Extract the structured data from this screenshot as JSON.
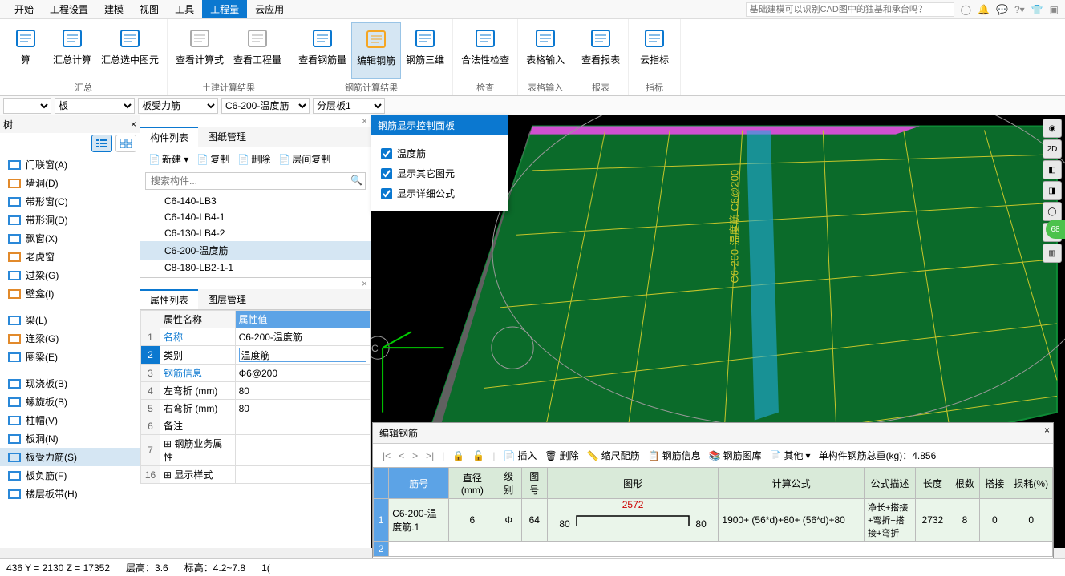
{
  "menu": {
    "items": [
      "开始",
      "工程设置",
      "建模",
      "视图",
      "工具",
      "工程量",
      "云应用"
    ],
    "active": 5,
    "search_placeholder": "基础建模可以识别CAD图中的独基和承台吗？"
  },
  "ribbon": {
    "groups": [
      {
        "label": "汇总",
        "buttons": [
          {
            "name": "calc",
            "label": "算",
            "color": "#0b78d0"
          },
          {
            "name": "sum-calc",
            "label": "汇总计算",
            "color": "#0b78d0"
          },
          {
            "name": "sum-select",
            "label": "汇总选中图元",
            "color": "#0b78d0"
          }
        ]
      },
      {
        "label": "土建计算结果",
        "buttons": [
          {
            "name": "view-formula",
            "label": "查看计算式",
            "color": "#aaa"
          },
          {
            "name": "view-engqty",
            "label": "查看工程量",
            "color": "#aaa"
          }
        ]
      },
      {
        "label": "钢筋计算结果",
        "buttons": [
          {
            "name": "view-rebar",
            "label": "查看钢筋量",
            "color": "#0b78d0"
          },
          {
            "name": "edit-rebar",
            "label": "编辑钢筋",
            "color": "#f5a623",
            "active": true
          },
          {
            "name": "rebar-3d",
            "label": "钢筋三维",
            "color": "#0b78d0"
          }
        ]
      },
      {
        "label": "检查",
        "buttons": [
          {
            "name": "legal-check",
            "label": "合法性检查",
            "color": "#0b78d0"
          }
        ]
      },
      {
        "label": "表格输入",
        "buttons": [
          {
            "name": "table-input",
            "label": "表格输入",
            "color": "#0b78d0"
          }
        ]
      },
      {
        "label": "报表",
        "buttons": [
          {
            "name": "view-report",
            "label": "查看报表",
            "color": "#0b78d0"
          }
        ]
      },
      {
        "label": "指标",
        "buttons": [
          {
            "name": "cloud-index",
            "label": "云指标",
            "color": "#0b78d0"
          }
        ]
      }
    ]
  },
  "selectors": [
    {
      "value": ""
    },
    {
      "value": "板"
    },
    {
      "value": "板受力筋"
    },
    {
      "value": "C6-200-温度筋"
    },
    {
      "value": "分层板1"
    }
  ],
  "left": {
    "title": "树",
    "items": [
      {
        "icon": "#2a88d8",
        "label": "门联窗(A)"
      },
      {
        "icon": "#e28a2b",
        "label": "墙洞(D)"
      },
      {
        "icon": "#2a88d8",
        "label": "带形窗(C)"
      },
      {
        "icon": "#2a88d8",
        "label": "带形洞(D)"
      },
      {
        "icon": "#2a88d8",
        "label": "飘窗(X)"
      },
      {
        "icon": "#e28a2b",
        "label": "老虎窗"
      },
      {
        "icon": "#2a88d8",
        "label": "过梁(G)"
      },
      {
        "icon": "#e28a2b",
        "label": "壁龛(I)"
      },
      {
        "icon": "",
        "label": ""
      },
      {
        "icon": "#2a88d8",
        "label": "梁(L)"
      },
      {
        "icon": "#e28a2b",
        "label": "连梁(G)"
      },
      {
        "icon": "#2a88d8",
        "label": "圈梁(E)"
      },
      {
        "icon": "",
        "label": ""
      },
      {
        "icon": "#2a88d8",
        "label": "现浇板(B)"
      },
      {
        "icon": "#2a88d8",
        "label": "螺旋板(B)"
      },
      {
        "icon": "#2a88d8",
        "label": "柱帽(V)"
      },
      {
        "icon": "#2a88d8",
        "label": "板洞(N)"
      },
      {
        "icon": "#2a88d8",
        "label": "板受力筋(S)",
        "sel": true
      },
      {
        "icon": "#2a88d8",
        "label": "板负筋(F)"
      },
      {
        "icon": "#2a88d8",
        "label": "楼层板带(H)"
      }
    ]
  },
  "mid": {
    "tabs": [
      "构件列表",
      "图纸管理"
    ],
    "active_tab": 0,
    "toolbar": [
      {
        "name": "new",
        "label": "新建",
        "drop": true
      },
      {
        "name": "copy",
        "label": "复制"
      },
      {
        "name": "delete",
        "label": "删除"
      },
      {
        "name": "layer-copy",
        "label": "层间复制"
      }
    ],
    "search_placeholder": "搜索构件...",
    "components": [
      "C6-140-LB3",
      "C6-140-LB4-1",
      "C6-130-LB4-2",
      "C6-200-温度筋",
      "C8-180-LB2-1-1"
    ],
    "selected": 3,
    "prop_tabs": [
      "属性列表",
      "图层管理"
    ],
    "prop_active": 0,
    "prop_headers": [
      "属性名称",
      "属性值"
    ],
    "props": [
      {
        "n": "1",
        "name": "名称",
        "value": "C6-200-温度筋",
        "link": true
      },
      {
        "n": "2",
        "name": "类别",
        "value": "温度筋",
        "sel": true,
        "edit": true
      },
      {
        "n": "3",
        "name": "钢筋信息",
        "value": "Φ6@200",
        "link": true
      },
      {
        "n": "4",
        "name": "左弯折 (mm)",
        "value": "80"
      },
      {
        "n": "5",
        "name": "右弯折 (mm)",
        "value": "80"
      },
      {
        "n": "6",
        "name": "备注",
        "value": ""
      },
      {
        "n": "7",
        "name": "钢筋业务属性",
        "value": "",
        "exp": true
      },
      {
        "n": "16",
        "name": "显示样式",
        "value": "",
        "exp": true
      }
    ]
  },
  "rebar_panel": {
    "title": "钢筋显示控制面板",
    "checks": [
      "温度筋",
      "显示其它图元",
      "显示详细公式"
    ]
  },
  "viewport": {
    "label": "C6-200-温度筋 C6@200"
  },
  "editor": {
    "title": "编辑钢筋",
    "nav": [
      "|<",
      "<",
      ">",
      ">|"
    ],
    "toolbar": [
      {
        "name": "insert",
        "label": "插入"
      },
      {
        "name": "delete",
        "label": "删除"
      },
      {
        "name": "scale",
        "label": "缩尺配筋"
      },
      {
        "name": "info",
        "label": "钢筋信息"
      },
      {
        "name": "library",
        "label": "钢筋图库"
      },
      {
        "name": "other",
        "label": "其他",
        "drop": true
      }
    ],
    "total_label": "单构件钢筋总重(kg)：",
    "total_value": "4.856",
    "headers": [
      "筋号",
      "直径(mm)",
      "级别",
      "图号",
      "图形",
      "计算公式",
      "公式描述",
      "长度",
      "根数",
      "搭接",
      "损耗(%)"
    ],
    "row": {
      "num": "1",
      "id": "C6-200-温度筋.1",
      "dia": "6",
      "grade": "Φ",
      "fig": "64",
      "left": "80",
      "mid": "2572",
      "right": "80",
      "formula": "1900+ (56*d)+80+ (56*d)+80",
      "desc": "净长+搭接+弯折+搭接+弯折",
      "len": "2732",
      "cnt": "8",
      "lap": "0",
      "loss": "0"
    },
    "row2": "2"
  },
  "status": {
    "coords": "436 Y = 2130 Z = 17352",
    "floor": "层高：3.6",
    "elev": "标高：4.2~7.8",
    "extra": "1("
  }
}
